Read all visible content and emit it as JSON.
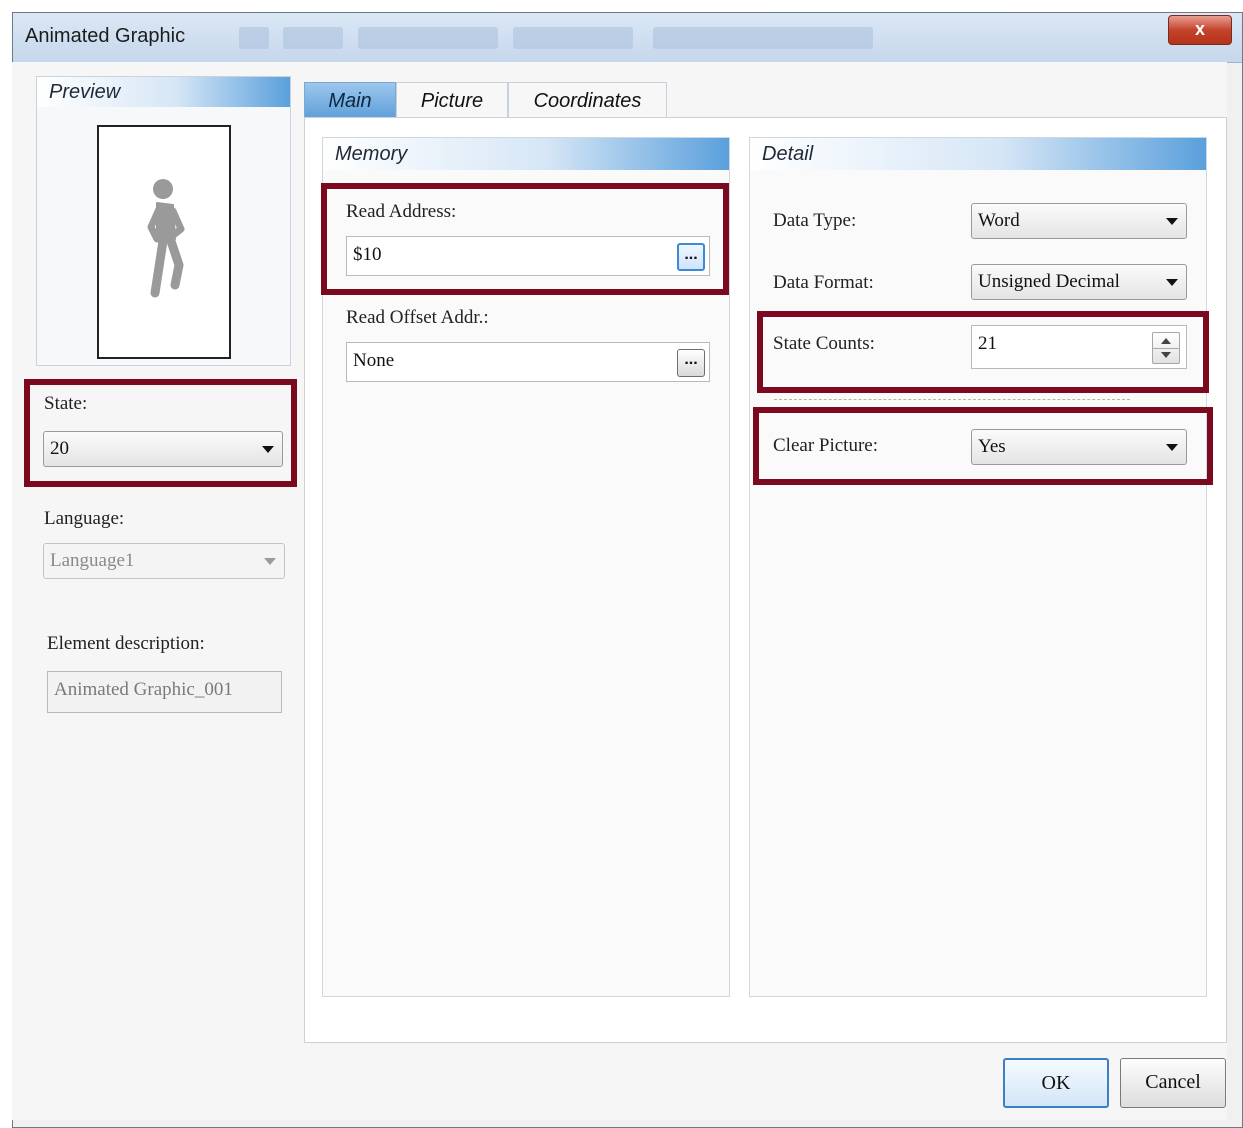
{
  "window": {
    "title": "Animated Graphic",
    "close_label": "x"
  },
  "preview": {
    "header": "Preview",
    "icon": "walking-person-icon"
  },
  "left": {
    "state_label": "State:",
    "state_value": "20",
    "language_label": "Language:",
    "language_value": "Language1",
    "description_label": "Element description:",
    "description_value": "Animated Graphic_001"
  },
  "tabs": [
    {
      "label": "Main",
      "active": true
    },
    {
      "label": "Picture",
      "active": false
    },
    {
      "label": "Coordinates",
      "active": false
    }
  ],
  "memory": {
    "header": "Memory",
    "read_address_label": "Read Address:",
    "read_address_value": "$10",
    "read_offset_label": "Read Offset Addr.:",
    "read_offset_value": "None",
    "browse_label": "..."
  },
  "detail": {
    "header": "Detail",
    "data_type_label": "Data Type:",
    "data_type_value": "Word",
    "data_format_label": "Data Format:",
    "data_format_value": "Unsigned Decimal",
    "state_counts_label": "State Counts:",
    "state_counts_value": "21",
    "clear_picture_label": "Clear Picture:",
    "clear_picture_value": "Yes"
  },
  "buttons": {
    "ok": "OK",
    "cancel": "Cancel"
  },
  "colors": {
    "highlight": "#7b0a1f",
    "accent": "#5aa0dc"
  }
}
